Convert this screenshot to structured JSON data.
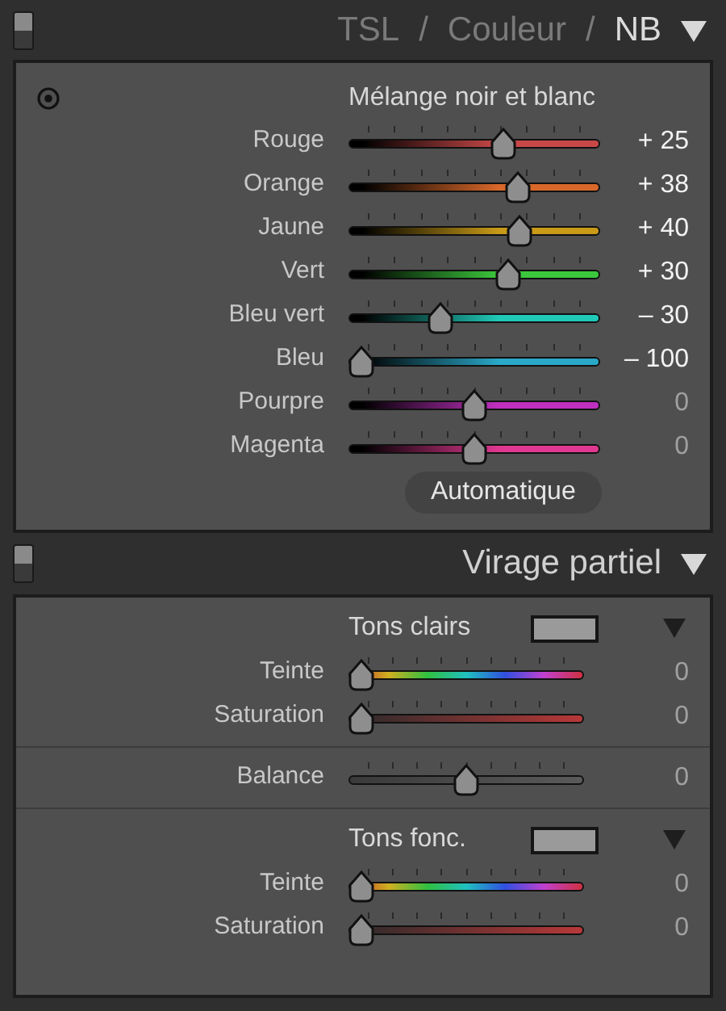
{
  "bw_header": {
    "items": [
      {
        "kind": "tab",
        "label": "TSL",
        "selected": false
      },
      {
        "kind": "separator",
        "label": "/"
      },
      {
        "kind": "tab",
        "label": "Couleur",
        "selected": false
      },
      {
        "kind": "separator",
        "label": "/"
      },
      {
        "kind": "tab",
        "label": "NB",
        "selected": true
      }
    ],
    "expanded": true,
    "on": true
  },
  "bw_mix": {
    "title": "Mélange noir et blanc",
    "sliders": [
      {
        "label": "Rouge",
        "level": 0.625,
        "reading": "+ 25",
        "modified": true,
        "color": "#c84848"
      },
      {
        "label": "Orange",
        "level": 0.69,
        "reading": "+ 38",
        "modified": true,
        "color": "#d8682a"
      },
      {
        "label": "Jaune",
        "level": 0.7,
        "reading": "+ 40",
        "modified": true,
        "color": "#c89a18"
      },
      {
        "label": "Vert",
        "level": 0.65,
        "reading": "+ 30",
        "modified": true,
        "color": "#3cc83c"
      },
      {
        "label": "Bleu vert",
        "level": 0.35,
        "reading": "– 30",
        "modified": true,
        "color": "#20c8b8"
      },
      {
        "label": "Bleu",
        "level": 0,
        "reading": "– 100",
        "modified": true,
        "color": "#2aa8c8"
      },
      {
        "label": "Pourpre",
        "level": 0.5,
        "reading": "0",
        "modified": false,
        "color": "#c030c0"
      },
      {
        "label": "Magenta",
        "level": 0.5,
        "reading": "0",
        "modified": false,
        "color": "#e03890"
      }
    ],
    "button": "Automatique"
  },
  "split_header": {
    "title": "Virage partiel",
    "expanded": true,
    "on": true
  },
  "split_toning": [
    {
      "kind": "tone",
      "title": "Tons clairs",
      "sliders": [
        {
          "kind": "hue",
          "label": "Teinte",
          "level": 0,
          "reading": "0",
          "modified": false
        },
        {
          "kind": "saturation",
          "label": "Saturation",
          "level": 0,
          "reading": "0",
          "modified": false
        }
      ]
    },
    {
      "kind": "balance",
      "sliders": [
        {
          "kind": "plain",
          "label": "Balance",
          "level": 0.5,
          "reading": "0",
          "modified": false
        }
      ]
    },
    {
      "kind": "tone",
      "title": "Tons fonc.",
      "sliders": [
        {
          "kind": "hue",
          "label": "Teinte",
          "level": 0,
          "reading": "0",
          "modified": false
        },
        {
          "kind": "saturation",
          "label": "Saturation",
          "level": 0,
          "reading": "0",
          "modified": false
        }
      ]
    }
  ]
}
